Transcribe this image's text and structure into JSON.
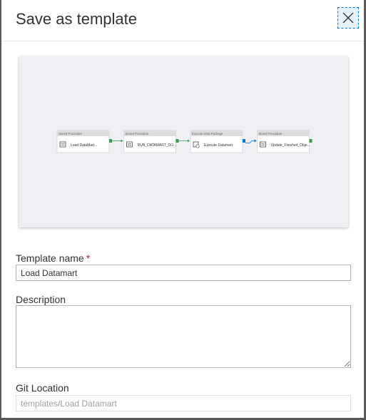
{
  "dialog": {
    "title": "Save as template",
    "close_icon": "close-icon"
  },
  "pipeline": {
    "activities": [
      {
        "type": "Stored Procedure",
        "name": "Load DataMart...",
        "icon": "stored-procedure-icon",
        "status_color": "#3a9c4a"
      },
      {
        "type": "Stored Procedure",
        "name": "RUN_DATAMART_DO...",
        "icon": "stored-procedure-icon",
        "status_color": "#3a9c4a"
      },
      {
        "type": "Execute SSIS Package",
        "name": "Execute Datamart",
        "icon": "ssis-package-icon",
        "status_color": "#0078d4"
      },
      {
        "type": "Stored Procedure",
        "name": "Update_Finished_Obje...",
        "icon": "stored-procedure-icon",
        "status_color": "#3a9c4a"
      }
    ],
    "connector_success_color": "#3a9c4a",
    "connector_blue_color": "#0078d4"
  },
  "form": {
    "template_name": {
      "label": "Template name",
      "required_mark": "*",
      "value": "Load Datamart"
    },
    "description": {
      "label": "Description",
      "value": ""
    },
    "git_location": {
      "label": "Git Location",
      "placeholder": "templates/Load Datamart"
    }
  },
  "colors": {
    "accent": "#0078d4",
    "required": "#a4262c",
    "border": "#b3b0ad"
  }
}
